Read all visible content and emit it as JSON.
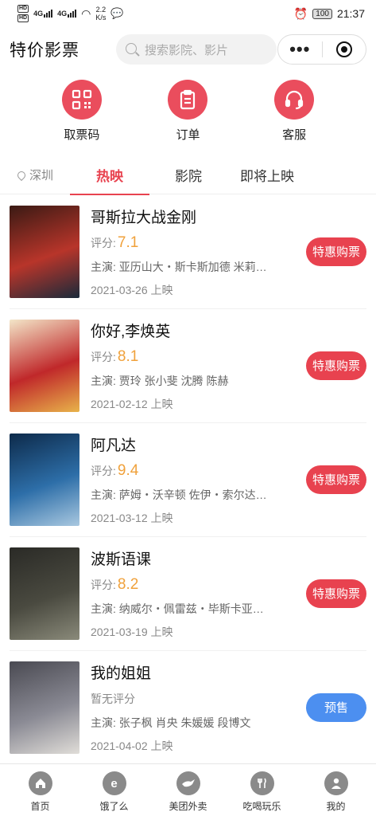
{
  "status_bar": {
    "sim1": "HD",
    "sim2": "HD",
    "net1": "4G",
    "net2": "4G",
    "speed": "2.2",
    "speed_unit": "K/s",
    "battery": "100",
    "time": "21:37"
  },
  "header": {
    "title": "特价影票",
    "search_placeholder": "搜索影院、影片",
    "more_icon": "more-icon",
    "target_icon": "target-icon"
  },
  "quick_actions": [
    {
      "label": "取票码",
      "icon": "qrcode-icon"
    },
    {
      "label": "订单",
      "icon": "clipboard-icon"
    },
    {
      "label": "客服",
      "icon": "headset-icon"
    }
  ],
  "tabs": {
    "location": "深圳",
    "items": [
      "热映",
      "影院",
      "即将上映"
    ],
    "active_index": 0
  },
  "movies": [
    {
      "title": "哥斯拉大战金刚",
      "rating_label": "评分:",
      "score": "7.1",
      "cast": "主演: 亚历山大・斯卡斯加德 米莉…",
      "date": "2021-03-26 上映",
      "button": "特惠购票",
      "poster_colors": [
        "#3a1a14",
        "#b8352a",
        "#1a2a3a"
      ]
    },
    {
      "title": "你好,李焕英",
      "rating_label": "评分:",
      "score": "8.1",
      "cast": "主演: 贾玲 张小斐 沈腾 陈赫",
      "date": "2021-02-12 上映",
      "button": "特惠购票",
      "poster_colors": [
        "#f3e6c8",
        "#c0282a",
        "#e8b34a"
      ]
    },
    {
      "title": "阿凡达",
      "rating_label": "评分:",
      "score": "9.4",
      "cast": "主演: 萨姆・沃辛顿 佐伊・索尔达…",
      "date": "2021-03-12 上映",
      "button": "特惠购票",
      "poster_colors": [
        "#0d2a4a",
        "#2d6ea8",
        "#a9c8e0"
      ]
    },
    {
      "title": "波斯语课",
      "rating_label": "评分:",
      "score": "8.2",
      "cast": "主演: 纳威尔・佩雷兹・毕斯卡亚…",
      "date": "2021-03-19 上映",
      "button": "特惠购票",
      "poster_colors": [
        "#2a2a26",
        "#4a4a40",
        "#8a8a7a"
      ]
    },
    {
      "title": "我的姐姐",
      "rating_label": "暂无评分",
      "score": "",
      "cast": "主演: 张子枫 肖央 朱媛媛 段博文",
      "date": "2021-04-02 上映",
      "button": "预售",
      "poster_colors": [
        "#4a4a52",
        "#8a8a94",
        "#e0ddd8"
      ]
    }
  ],
  "bottom_nav": [
    {
      "label": "首页",
      "icon": "home-icon"
    },
    {
      "label": "饿了么",
      "icon": "eleme-icon"
    },
    {
      "label": "美团外卖",
      "icon": "kangaroo-icon"
    },
    {
      "label": "吃喝玩乐",
      "icon": "cutlery-icon"
    },
    {
      "label": "我的",
      "icon": "user-icon"
    }
  ],
  "colors": {
    "accent": "#e8424f",
    "score": "#f0a13b",
    "presale": "#4c8ff0",
    "nav_icon": "#8a8a8a"
  }
}
